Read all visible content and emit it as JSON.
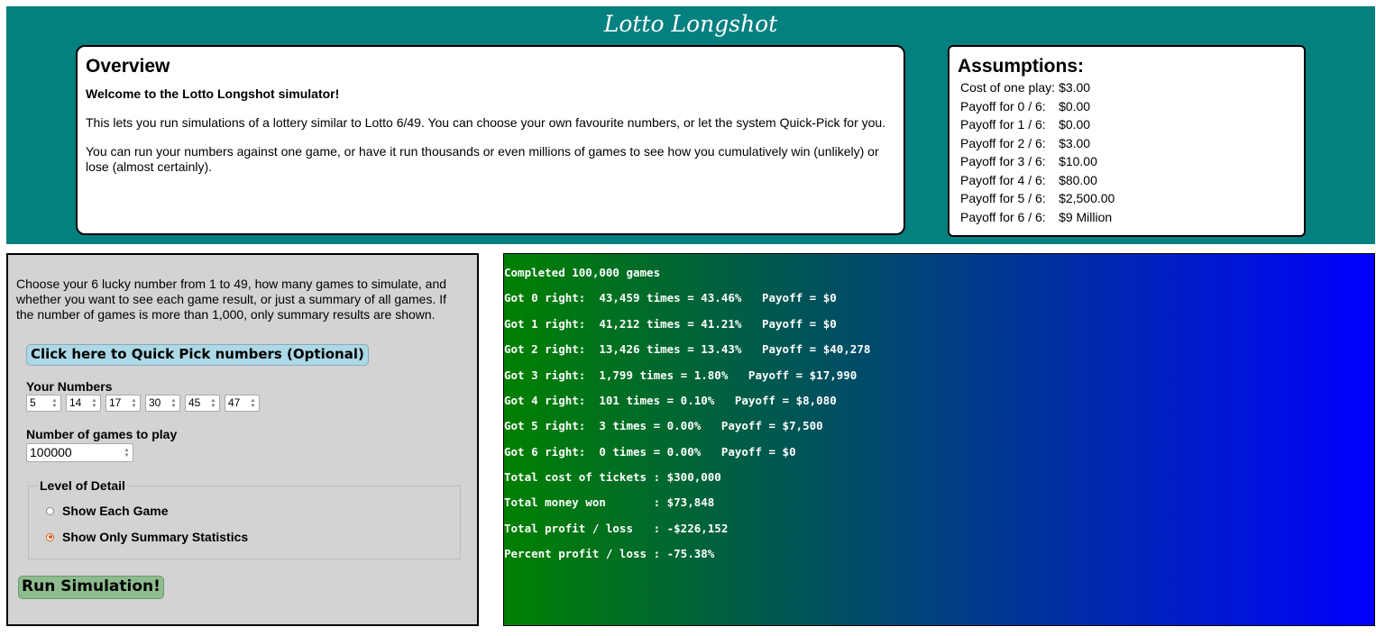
{
  "app": {
    "title": "Lotto Longshot"
  },
  "overview": {
    "heading": "Overview",
    "welcome": "Welcome to the Lotto Longshot simulator!",
    "para1": "This lets you run simulations of a lottery similar to Lotto 6/49. You can choose your own favourite numbers, or let the system Quick-Pick for you.",
    "para2": "You can run your numbers against one game, or have it run thousands or even millions of games to see how you cumulatively win (unlikely) or lose (almost certainly)."
  },
  "assumptions": {
    "heading": "Assumptions:",
    "rows": [
      {
        "label": "Cost of one play:",
        "value": "$3.00"
      },
      {
        "label": "Payoff for 0 / 6:",
        "value": "$0.00"
      },
      {
        "label": "Payoff for 1 / 6:",
        "value": "$0.00"
      },
      {
        "label": "Payoff for 2 / 6:",
        "value": "$3.00"
      },
      {
        "label": "Payoff for 3 / 6:",
        "value": "$10.00"
      },
      {
        "label": "Payoff for 4 / 6:",
        "value": "$80.00"
      },
      {
        "label": "Payoff for 5 / 6:",
        "value": "$2,500.00"
      },
      {
        "label": "Payoff for 6 / 6:",
        "value": "$9 Million"
      }
    ]
  },
  "controls": {
    "intro": "Choose your 6 lucky number from 1 to 49, how many games to simulate, and whether you want to see each game result, or just a summary of all games. If the number of games is more than 1,000, only summary results are shown.",
    "quick_pick_label": "Click here to Quick Pick numbers (Optional)",
    "your_numbers_label": "Your Numbers",
    "numbers": [
      "5",
      "14",
      "17",
      "30",
      "45",
      "47"
    ],
    "games_label": "Number of games to play",
    "games_value": "100000",
    "detail_legend": "Level of Detail",
    "detail_options": [
      {
        "label": "Show Each Game",
        "checked": false
      },
      {
        "label": "Show Only Summary Statistics",
        "checked": true
      }
    ],
    "run_label": "Run Simulation!"
  },
  "results": {
    "lines": [
      "Completed 100,000 games",
      "Got 0 right:  43,459 times = 43.46%   Payoff = $0",
      "Got 1 right:  41,212 times = 41.21%   Payoff = $0",
      "Got 2 right:  13,426 times = 13.43%   Payoff = $40,278",
      "Got 3 right:  1,799 times = 1.80%   Payoff = $17,990",
      "Got 4 right:  101 times = 0.10%   Payoff = $8,080",
      "Got 5 right:  3 times = 0.00%   Payoff = $7,500",
      "Got 6 right:  0 times = 0.00%   Payoff = $0",
      "Total cost of tickets : $300,000",
      "Total money won       : $73,848",
      "Total profit / loss   : -$226,152",
      "Percent profit / loss : -75.38%"
    ]
  },
  "colors": {
    "header_bg": "#058080",
    "panel_bg": "#d3d3d3",
    "quick_pick_bg": "#add8e6",
    "run_bg": "#8fbc8f",
    "results_gradient_start": "#008000",
    "results_gradient_end": "#0000ff"
  }
}
